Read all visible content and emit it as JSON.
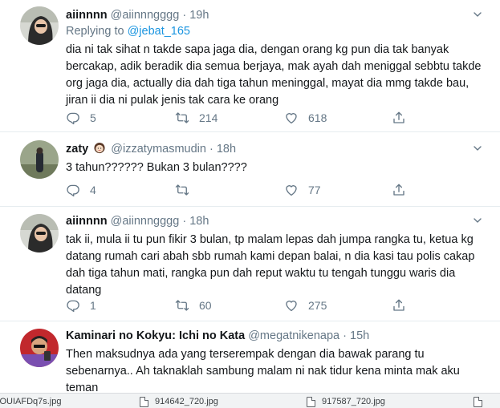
{
  "tweets": [
    {
      "name": "aiinnnn",
      "handle": "@aiinnngggg",
      "time": "19h",
      "replying_prefix": "Replying to",
      "replying_to": "@jebat_165",
      "text": "dia ni tak sihat n takde sapa jaga dia, dengan orang kg pun dia tak banyak bercakap, adik beradik dia semua berjaya, mak ayah dah meniggal sebbtu takde org jaga dia, actually dia dah tiga tahun meninggal, mayat dia mmg takde bau, jiran ii dia ni pulak jenis tak cara ke orang",
      "replies": "5",
      "retweets": "214",
      "likes": "618"
    },
    {
      "name": "zaty",
      "handle": "@izzatymasmudin",
      "time": "18h",
      "text": "3 tahun?????? Bukan 3 bulan????",
      "replies": "4",
      "retweets": "",
      "likes": "77"
    },
    {
      "name": "aiinnnn",
      "handle": "@aiinnngggg",
      "time": "18h",
      "text": "tak ii, mula ii tu pun fikir 3 bulan, tp malam lepas dah jumpa rangka tu, ketua kg datang rumah cari abah sbb rumah kami depan balai, n dia kasi tau polis cakap dah tiga tahun mati, rangka pun dah reput waktu tu tengah tunggu waris dia datang",
      "replies": "1",
      "retweets": "60",
      "likes": "275"
    },
    {
      "name": "Kaminari no Kokyu: Ichi no Kata",
      "handle": "@megatnikenapa",
      "time": "15h",
      "text": "Then maksudnya ada yang terserempak dengan dia bawak parang tu sebenarnya.. Ah taknaklah sambung malam ni nak tidur kena minta mak aku teman"
    }
  ],
  "separator": "·",
  "downloads": [
    {
      "filename": "gPOUIAFDq7s.jpg"
    },
    {
      "filename": "914642_720.jpg"
    },
    {
      "filename": "917587_720.jpg"
    }
  ],
  "icons": {
    "reply": "reply-icon",
    "retweet": "retweet-icon",
    "like": "heart-icon",
    "share": "share-icon",
    "caret": "chevron-down-icon"
  },
  "colors": {
    "link": "#1b95e0",
    "secondary_text": "#657786",
    "divider": "#e6ecf0"
  }
}
